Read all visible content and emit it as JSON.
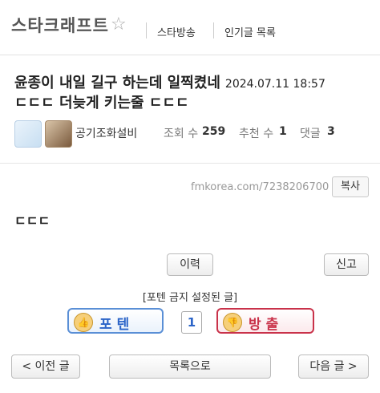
{
  "header": {
    "board_title": "스타크래프트",
    "links": [
      "스타방송",
      "인기글 목록"
    ]
  },
  "post": {
    "title_line1": "윤종이 내일 길구 하는데 일찍켰네",
    "date": "2024.07.11 18:57",
    "title_line2": "ㄷㄷㄷ 더늦게 키는줄 ㄷㄷㄷ",
    "author": "공기조화설비",
    "views_label": "조회 수",
    "views": "259",
    "recommend_label": "추천 수",
    "recommend": "1",
    "comments_label": "댓글",
    "comments": "3",
    "url": "fmkorea.com/7238206700",
    "copy_label": "복사",
    "body": "ㄷㄷㄷ"
  },
  "actions": {
    "history_label": "이력",
    "report_label": "신고",
    "notice": "[포텐 금지 설정된 글]",
    "vote_up_label": "포텐",
    "vote_count": "1",
    "vote_down_label": "방출"
  },
  "nav": {
    "prev_label": "< 이전 글",
    "list_label": "목록으로",
    "next_label": "다음 글 >"
  },
  "colors": {
    "vote_up": "#2b64c8",
    "vote_down": "#c9324a"
  }
}
